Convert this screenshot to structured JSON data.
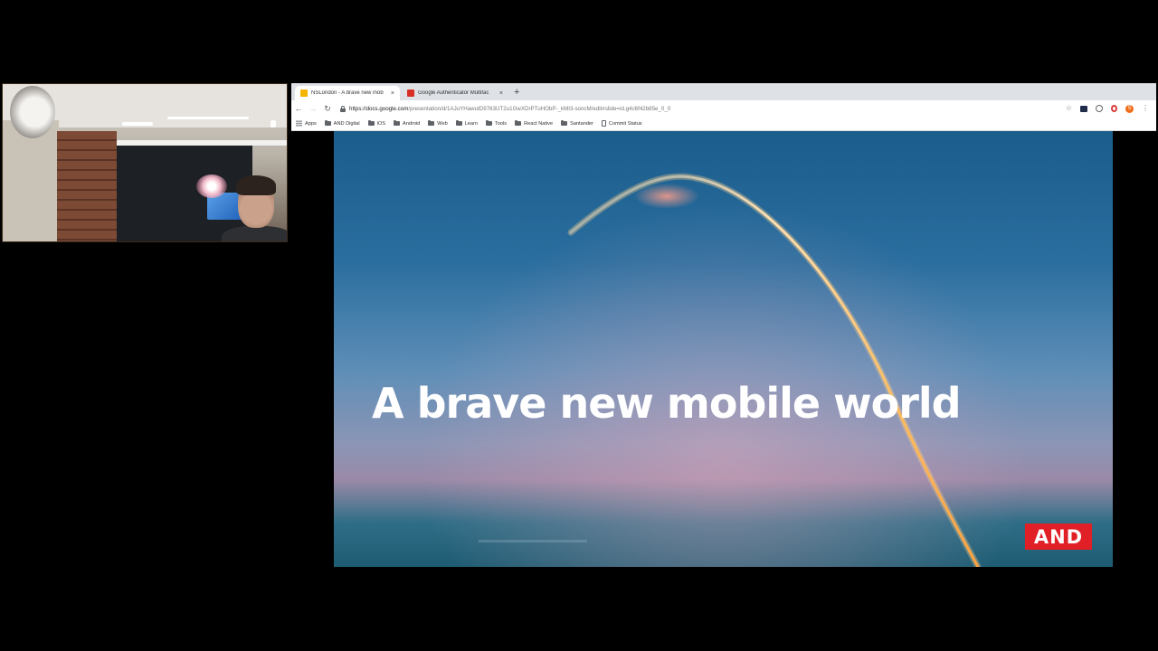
{
  "browser": {
    "tabs": [
      {
        "title": "NSLondon - A brave new mob",
        "active": true,
        "favicon_color": "#f4b400"
      },
      {
        "title": "Google Authenticator Multifac",
        "active": false,
        "favicon_color": "#d93025"
      }
    ],
    "new_tab_label": "+",
    "close_label": "×",
    "url_host": "https://docs.google.com",
    "url_path": "/presentation/d/1AJuYHawutD9763UT2u1GwXDrPTuHObP-_kMI3-soncM/edit#slide=id.g4c6f42b85e_0_0",
    "profile_initial": "S",
    "bookmarks": [
      {
        "label": "Apps",
        "icon": "apps-grid-icon"
      },
      {
        "label": "AND Digital",
        "icon": "folder-icon"
      },
      {
        "label": "iOS",
        "icon": "folder-icon"
      },
      {
        "label": "Android",
        "icon": "folder-icon"
      },
      {
        "label": "Web",
        "icon": "folder-icon"
      },
      {
        "label": "Learn",
        "icon": "folder-icon"
      },
      {
        "label": "Tools",
        "icon": "folder-icon"
      },
      {
        "label": "React Native",
        "icon": "folder-icon"
      },
      {
        "label": "Santander",
        "icon": "folder-icon"
      },
      {
        "label": "Commit Status",
        "icon": "document-icon"
      }
    ]
  },
  "slide": {
    "title": "A brave new mobile world",
    "logo_text": "AND",
    "logo_color": "#e11f26"
  }
}
